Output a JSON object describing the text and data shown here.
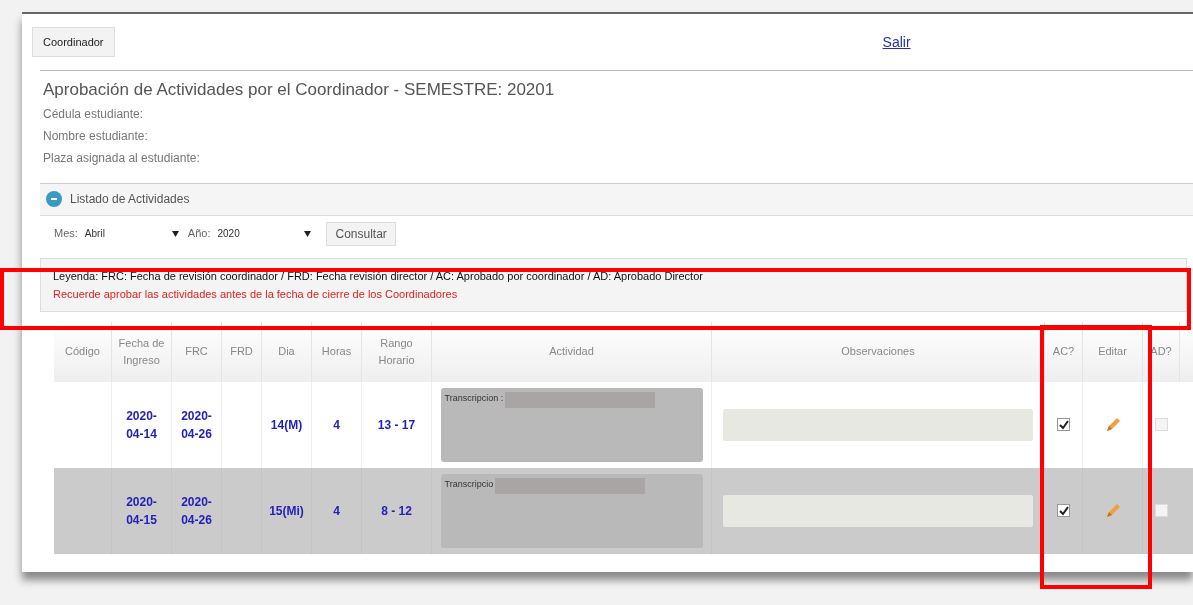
{
  "top_button": "Coordinador",
  "logout_link": "Salir",
  "title": "Aprobación de Actividades por el Coordinador - SEMESTRE: 20201",
  "student_fields": [
    {
      "label": "Cédula estudiante:"
    },
    {
      "label": "Nombre estudiante:"
    },
    {
      "label": "Plaza asignada al estudiante:"
    }
  ],
  "panel": {
    "title": "Listado de Actividades",
    "expanded": true
  },
  "filters": {
    "month_label": "Mes:",
    "month": "Abril",
    "year_label": "Año:",
    "year": "2020",
    "button": "Consultar"
  },
  "legend": {
    "text": "Leyenda: FRC: Fecha de revisión coordinador / FRD: Fecha revisión director / AC: Aprobado por coordinador / AD: Aprobado Director",
    "warning": "Recuerde aprobar las actividades antes de la fecha de cierre de los Coordinadores"
  },
  "table": {
    "columns": [
      "Código",
      "Fecha de Ingreso",
      "FRC",
      "FRD",
      "Dia",
      "Horas",
      "Rango Horario",
      "Actividad",
      "Observaciones",
      "AC?",
      "Editar",
      "AD?"
    ],
    "rows": [
      {
        "fecha": "2020-\n04-14",
        "frc": "2020-\n04-26",
        "dia": "14(M)",
        "horas": "4",
        "rango": "13 - 17",
        "actividad": "Transcripcion :",
        "ac": true,
        "ad": false,
        "selected": false
      },
      {
        "fecha": "2020-\n04-15",
        "frc": "2020-\n04-26",
        "dia": "15(Mi)",
        "horas": "4",
        "rango": "8 - 12",
        "actividad": "Transcripcio",
        "ac": true,
        "ad": false,
        "selected": true
      }
    ]
  }
}
